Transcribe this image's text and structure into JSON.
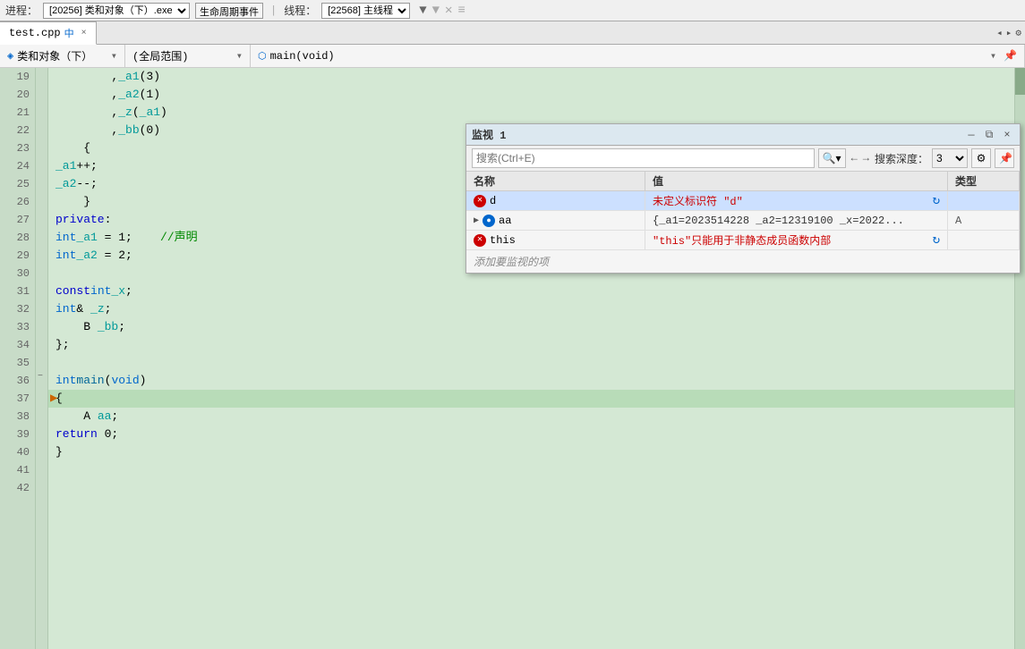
{
  "toolbar": {
    "process_label": "进程：",
    "process_value": "[20256] 类和对象（下）.exe",
    "lifecycle_btn": "生命周期事件",
    "thread_label": "线程：",
    "thread_value": "[22568] 主线程"
  },
  "tab": {
    "filename": "test.cpp",
    "pin_icon": "中",
    "close_icon": "×"
  },
  "code_nav": {
    "class_scope": "类和对象（下）",
    "global_scope": "(全局范围)",
    "function_scope": "main(void)"
  },
  "lines": [
    {
      "num": 19,
      "code": "        ,_a1(3)"
    },
    {
      "num": 20,
      "code": "        ,_a2(1)"
    },
    {
      "num": 21,
      "code": "        ,_z(_a1)"
    },
    {
      "num": 22,
      "code": "        ,_bb(0)"
    },
    {
      "num": 23,
      "code": "    {"
    },
    {
      "num": 24,
      "code": "        _a1++;"
    },
    {
      "num": 25,
      "code": "        _a2--;"
    },
    {
      "num": 26,
      "code": "    }"
    },
    {
      "num": 27,
      "code": "private:"
    },
    {
      "num": 28,
      "code": "    int _a1 = 1;    //声明"
    },
    {
      "num": 29,
      "code": "    int _a2 = 2;"
    },
    {
      "num": 30,
      "code": ""
    },
    {
      "num": 31,
      "code": "    const int _x;"
    },
    {
      "num": 32,
      "code": "    int& _z;"
    },
    {
      "num": 33,
      "code": "    B _bb;"
    },
    {
      "num": 34,
      "code": "};"
    },
    {
      "num": 35,
      "code": ""
    },
    {
      "num": 36,
      "code": "int main(void)",
      "is_arrow": true
    },
    {
      "num": 37,
      "code": "{"
    },
    {
      "num": 38,
      "code": "    A aa;"
    },
    {
      "num": 39,
      "code": "    return 0;"
    },
    {
      "num": 40,
      "code": "}"
    },
    {
      "num": 41,
      "code": ""
    },
    {
      "num": 42,
      "code": ""
    }
  ],
  "watch": {
    "title": "监视 1",
    "search_placeholder": "搜索(Ctrl+E)",
    "search_depth_label": "搜索深度：",
    "search_depth_value": "3",
    "nav_back": "←",
    "nav_forward": "→",
    "col_name": "名称",
    "col_value": "值",
    "col_type": "类型",
    "rows": [
      {
        "icon": "error",
        "name": "d",
        "value": "未定义标识符 \"d\"",
        "type": "",
        "has_refresh": true,
        "selected": true
      },
      {
        "icon": "object",
        "name": "aa",
        "value": "{_a1=2023514228 _a2=12319100 _x=2022...",
        "type": "A",
        "has_refresh": false,
        "selected": false,
        "expandable": true
      },
      {
        "icon": "error",
        "name": "this",
        "value": "\"this\"只能用于非静态成员函数内部",
        "type": "",
        "has_refresh": true,
        "selected": false
      }
    ],
    "add_row_text": "添加要监视的项"
  }
}
